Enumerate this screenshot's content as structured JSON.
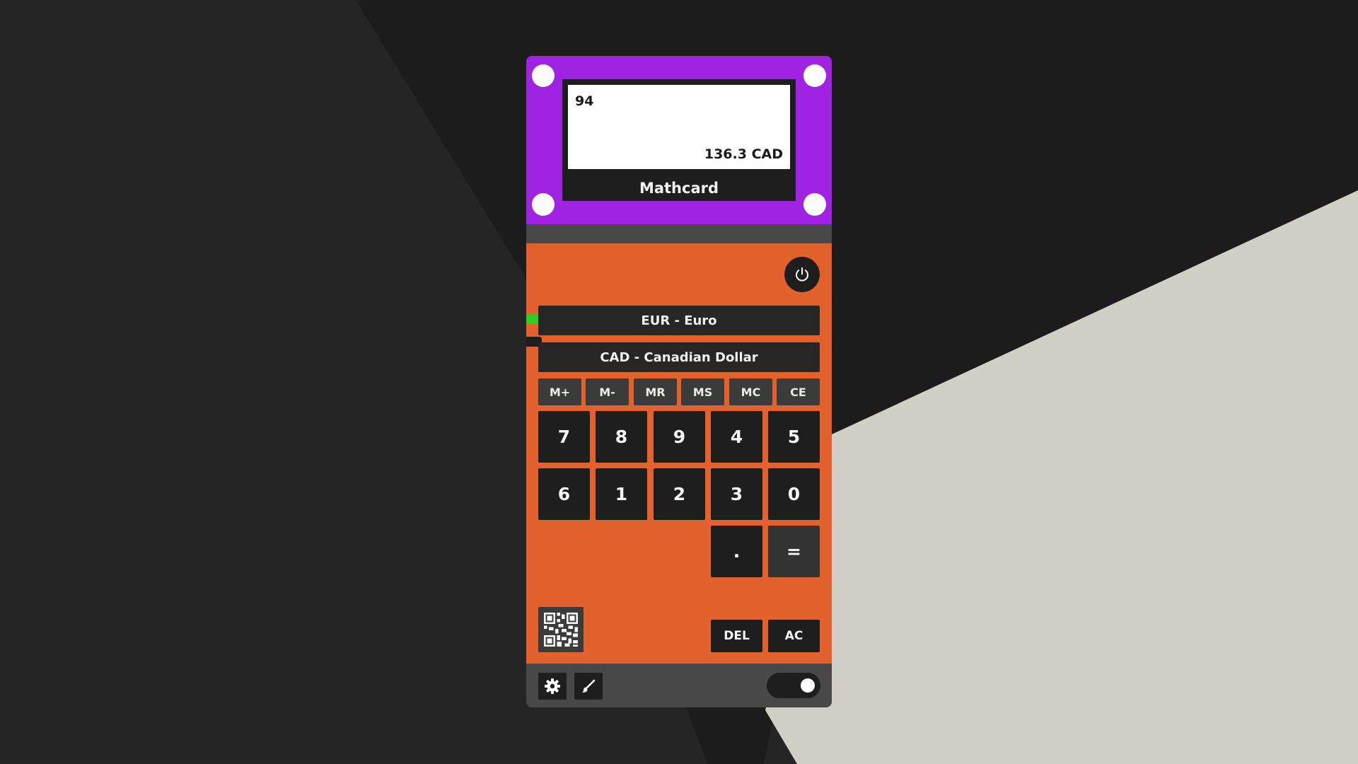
{
  "colors": {
    "screen_frame": "#a023e4",
    "body_panel": "#e2612d",
    "key": "#1e1e1e",
    "led_on": "#2ecc23",
    "background_dark": "#1c1c1c",
    "background_light": "#d0d0c6"
  },
  "display": {
    "input_value": "94",
    "result_value": "136.3 CAD",
    "brand": "Mathcard"
  },
  "currency": {
    "from_label": "EUR - Euro",
    "to_label": "CAD - Canadian Dollar"
  },
  "memory": {
    "buttons": [
      "M+",
      "M-",
      "MR",
      "MS",
      "MC",
      "CE"
    ]
  },
  "keypad": {
    "row1": [
      "7",
      "8",
      "9",
      "4",
      "5"
    ],
    "row2": [
      "6",
      "1",
      "2",
      "3",
      "0"
    ],
    "decimal": ".",
    "equals": "="
  },
  "actions": {
    "delete": "DEL",
    "clear_all": "AC"
  },
  "icons": {
    "power": "power-icon",
    "qr": "qr-code-icon",
    "settings": "gear-icon",
    "theme": "brush-icon"
  },
  "toggle": {
    "state": "on"
  }
}
